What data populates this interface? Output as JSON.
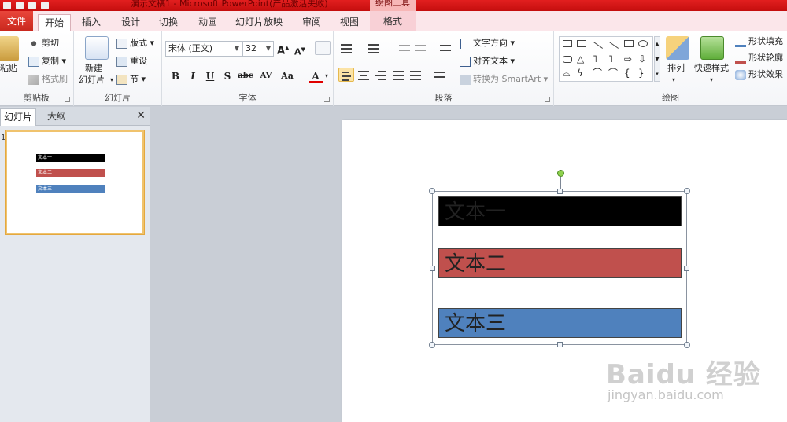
{
  "window": {
    "title": "演示文稿1 - Microsoft PowerPoint(产品激活失败)",
    "contextual_group": "绘图工具"
  },
  "tabs": [
    "文件",
    "开始",
    "插入",
    "设计",
    "切换",
    "动画",
    "幻灯片放映",
    "审阅",
    "视图",
    "格式"
  ],
  "ribbon": {
    "clipboard": {
      "paste": "粘贴",
      "cut": "剪切",
      "copy": "复制",
      "format_painter": "格式刷",
      "label": "剪贴板"
    },
    "slides": {
      "new_slide_line1": "新建",
      "new_slide_line2": "幻灯片",
      "layout": "版式",
      "reset": "重设",
      "section": "节",
      "label": "幻灯片"
    },
    "font": {
      "font_name": "宋体 (正文)",
      "font_size": "32",
      "bold": "B",
      "italic": "I",
      "underline": "U",
      "shadow": "S",
      "strike": "abc",
      "spacing": "AV",
      "case": "Aa",
      "color": "A",
      "grow": "A",
      "shrink": "A",
      "label": "字体"
    },
    "paragraph": {
      "text_direction": "文字方向",
      "align_text": "对齐文本",
      "smartart": "转换为 SmartArt",
      "label": "段落"
    },
    "drawing": {
      "arrange": "排列",
      "quick_styles": "快速样式",
      "shape_fill": "形状填充",
      "shape_outline": "形状轮廓",
      "shape_effects": "形状效果",
      "label": "绘图"
    }
  },
  "pane": {
    "tab_slides": "幻灯片",
    "tab_outline": "大纲",
    "close": "✕",
    "slide_number": "1"
  },
  "slide": {
    "boxes": [
      {
        "text": "文本一",
        "color": "#000000"
      },
      {
        "text": "文本二",
        "color": "#c0504d"
      },
      {
        "text": "文本三",
        "color": "#4f81bd"
      }
    ]
  },
  "watermark": {
    "brand": "Baidu 经验",
    "url": "jingyan.baidu.com"
  }
}
